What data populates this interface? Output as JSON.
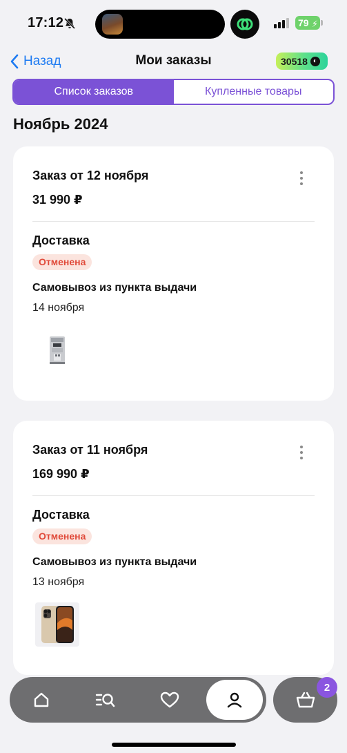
{
  "status_bar": {
    "time": "17:12",
    "battery": "79"
  },
  "header": {
    "back_label": "Назад",
    "title": "Мои заказы",
    "bonus": "30518"
  },
  "tabs": [
    {
      "label": "Список заказов",
      "active": true
    },
    {
      "label": "Купленные товары",
      "active": false
    }
  ],
  "month": "Ноябрь 2024",
  "orders": [
    {
      "title": "Заказ от 12 ноября",
      "sum": "31 990 ₽",
      "delivery_label": "Доставка",
      "status": "Отменена",
      "method": "Самовывоз из пункта выдачи",
      "date": "14 ноября",
      "item_icon": "coffee-machine-icon"
    },
    {
      "title": "Заказ от 11 ноября",
      "sum": "169 990 ₽",
      "delivery_label": "Доставка",
      "status": "Отменена",
      "method": "Самовывоз из пункта выдачи",
      "date": "13 ноября",
      "item_icon": "smartphone-icon"
    }
  ],
  "bottom_nav": {
    "items": [
      "home-icon",
      "catalog-search-icon",
      "favorites-heart-icon",
      "profile-icon"
    ],
    "cart_count": "2"
  },
  "colors": {
    "accent": "#7b52d6",
    "link": "#1e7bf2",
    "status_cancelled_bg": "#fbe4de",
    "status_cancelled_text": "#e04a3a",
    "nav_bg": "#6e6e70"
  }
}
